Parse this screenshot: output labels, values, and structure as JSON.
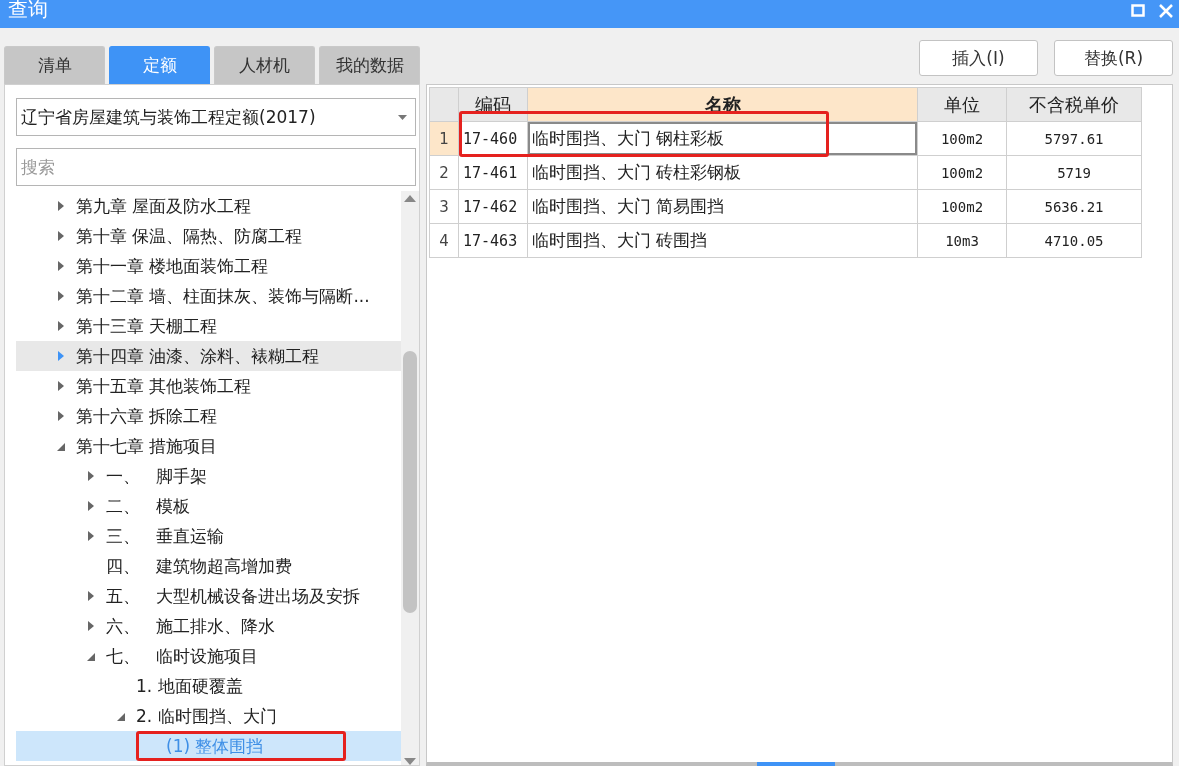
{
  "window": {
    "title": "查询"
  },
  "tabs": [
    {
      "label": "清单",
      "selected": false
    },
    {
      "label": "定额",
      "selected": true
    },
    {
      "label": "人材机",
      "selected": false
    },
    {
      "label": "我的数据",
      "selected": false
    }
  ],
  "buttons": [
    "插入(I)",
    "替换(R)"
  ],
  "library_select": {
    "value": "辽宁省房屋建筑与装饰工程定额(2017)"
  },
  "search": {
    "placeholder": "搜索"
  },
  "tree": [
    {
      "label": "第九章 屋面及防水工程",
      "expandable": true,
      "expanded": false,
      "selected": false,
      "hovered": false,
      "highlighted": false
    },
    {
      "label": "第十章 保温、隔热、防腐工程",
      "expandable": true,
      "expanded": false,
      "selected": false,
      "hovered": false,
      "highlighted": false
    },
    {
      "label": "第十一章 楼地面装饰工程",
      "expandable": true,
      "expanded": false,
      "selected": false,
      "hovered": false,
      "highlighted": false
    },
    {
      "label": "第十二章 墙、柱面抹灰、装饰与隔断...",
      "expandable": true,
      "expanded": false,
      "selected": false,
      "hovered": false,
      "highlighted": false
    },
    {
      "label": "第十三章 天棚工程",
      "expandable": true,
      "expanded": false,
      "selected": false,
      "hovered": false,
      "highlighted": false
    },
    {
      "label": "第十四章 油漆、涂料、裱糊工程",
      "expandable": true,
      "expanded": false,
      "selected": false,
      "hovered": true,
      "highlighted": false
    },
    {
      "label": "第十五章 其他装饰工程",
      "expandable": true,
      "expanded": false,
      "selected": false,
      "hovered": false,
      "highlighted": false
    },
    {
      "label": "第十六章 拆除工程",
      "expandable": true,
      "expanded": false,
      "selected": false,
      "hovered": false,
      "highlighted": false
    },
    {
      "label": "第十七章 措施项目",
      "expandable": true,
      "expanded": true,
      "selected": false,
      "hovered": false,
      "highlighted": false,
      "children": [
        {
          "number": "一、",
          "label": "脚手架",
          "expandable": true,
          "expanded": false,
          "selected": false,
          "hovered": false,
          "highlighted": false
        },
        {
          "number": "二、",
          "label": "模板",
          "expandable": true,
          "expanded": false,
          "selected": false,
          "hovered": false,
          "highlighted": false
        },
        {
          "number": "三、",
          "label": "垂直运输",
          "expandable": true,
          "expanded": false,
          "selected": false,
          "hovered": false,
          "highlighted": false
        },
        {
          "number": "四、",
          "label": "建筑物超高增加费",
          "expandable": false,
          "selected": false,
          "hovered": false,
          "highlighted": false
        },
        {
          "number": "五、",
          "label": "大型机械设备进出场及安拆",
          "expandable": true,
          "expanded": false,
          "selected": false,
          "hovered": false,
          "highlighted": false
        },
        {
          "number": "六、",
          "label": "施工排水、降水",
          "expandable": true,
          "expanded": false,
          "selected": false,
          "hovered": false,
          "highlighted": false
        },
        {
          "number": "七、",
          "label": "临时设施项目",
          "expandable": true,
          "expanded": true,
          "selected": false,
          "hovered": false,
          "highlighted": false,
          "children": [
            {
              "label": "1. 地面硬覆盖",
              "expandable": false,
              "selected": false,
              "hovered": false,
              "highlighted": false
            },
            {
              "label": "2. 临时围挡、大门",
              "expandable": true,
              "expanded": true,
              "selected": false,
              "hovered": false,
              "highlighted": false,
              "children": [
                {
                  "label": "(1) 整体围挡",
                  "expandable": false,
                  "selected": true,
                  "hovered": false,
                  "highlighted": true
                }
              ]
            }
          ]
        }
      ]
    }
  ],
  "table": {
    "columns": [
      {
        "label": "编码",
        "selected": false
      },
      {
        "label": "名称",
        "selected": true
      },
      {
        "label": "单位",
        "selected": false
      },
      {
        "label": "不含税单价",
        "selected": false
      }
    ],
    "rows": [
      {
        "index": "1",
        "code": "17-460",
        "name": "临时围挡、大门 钢柱彩板",
        "unit": "100m2",
        "price": "5797.61",
        "selected": true,
        "highlighted": true
      },
      {
        "index": "2",
        "code": "17-461",
        "name": "临时围挡、大门 砖柱彩钢板",
        "unit": "100m2",
        "price": "5719",
        "selected": false,
        "highlighted": false
      },
      {
        "index": "3",
        "code": "17-462",
        "name": "临时围挡、大门 简易围挡",
        "unit": "100m2",
        "price": "5636.21",
        "selected": false,
        "highlighted": false
      },
      {
        "index": "4",
        "code": "17-463",
        "name": "临时围挡、大门 砖围挡",
        "unit": "10m3",
        "price": "4710.05",
        "selected": false,
        "highlighted": false
      }
    ]
  }
}
